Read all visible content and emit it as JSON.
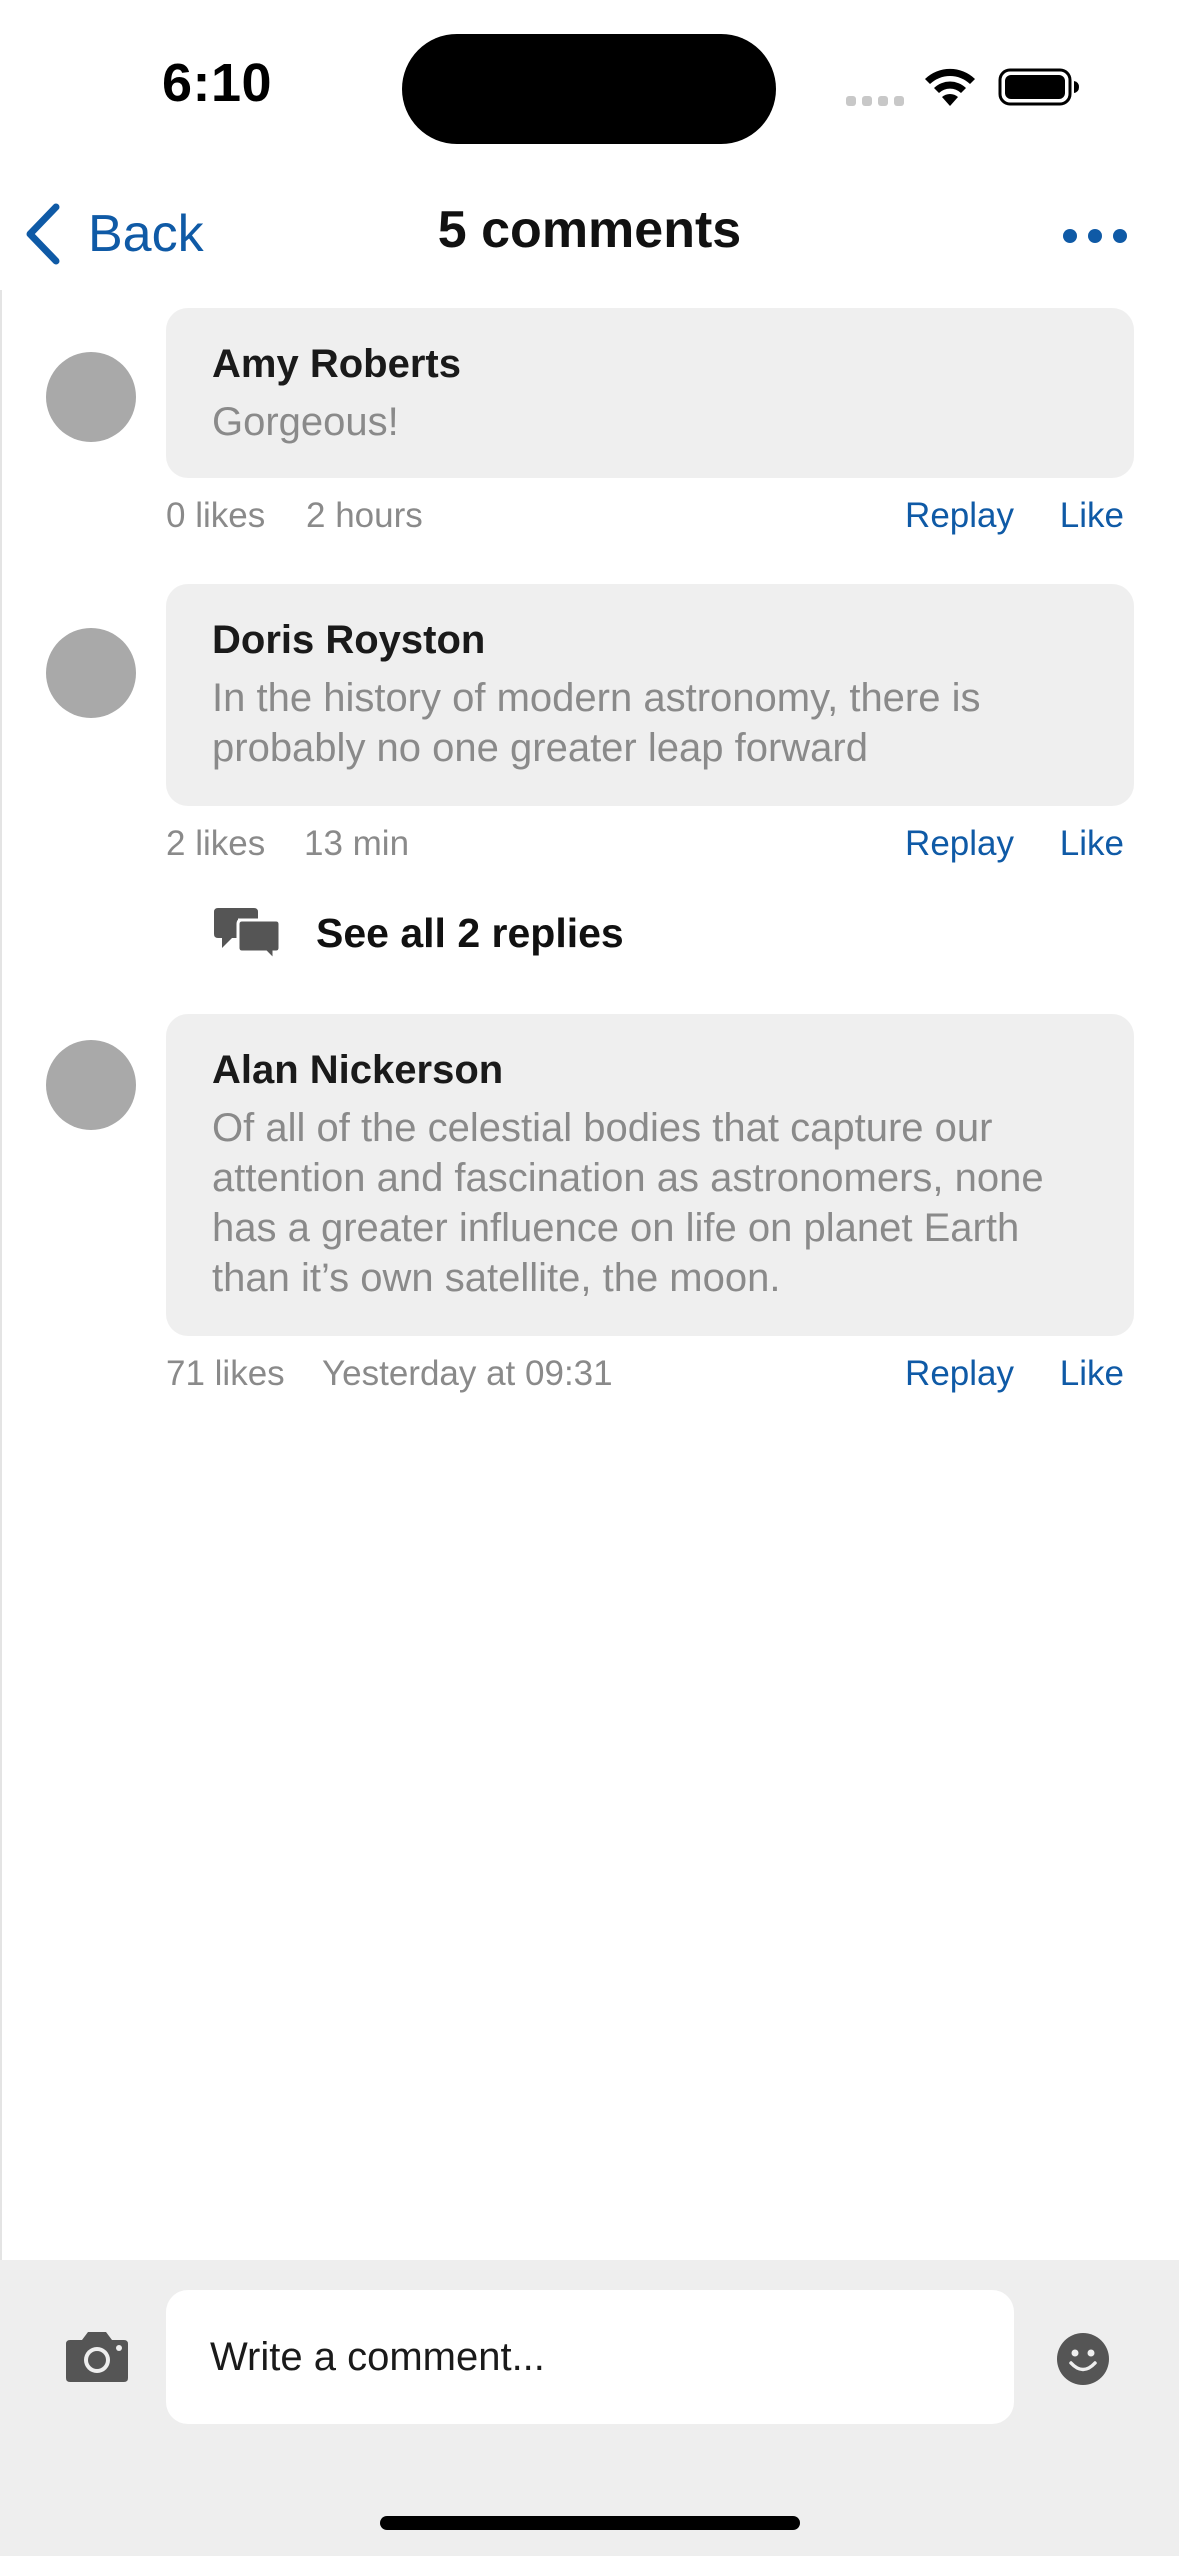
{
  "status_bar": {
    "time": "6:10"
  },
  "nav": {
    "back_label": "Back",
    "title": "5 comments"
  },
  "comments": [
    {
      "author": "Amy Roberts",
      "text": "Gorgeous!",
      "likes": "0 likes",
      "time": "2 hours",
      "reply_label": "Replay",
      "like_label": "Like"
    },
    {
      "author": "Doris Royston",
      "text": "In the history of modern astronomy, there is probably no one greater leap forward",
      "likes": "2 likes",
      "time": "13 min",
      "reply_label": "Replay",
      "like_label": "Like",
      "replies_label": "See all 2 replies"
    },
    {
      "author": "Alan Nickerson",
      "text": "Of all of the celestial bodies that capture our attention and fascination as astronomers, none has a greater influence on life on planet Earth than it’s own satellite, the moon.",
      "likes": "71 likes",
      "time": "Yesterday at 09:31",
      "reply_label": "Replay",
      "like_label": "Like"
    }
  ],
  "composer": {
    "placeholder": "Write a comment..."
  },
  "colors": {
    "accent": "#0f5aa6",
    "bubble": "#efefef",
    "muted_text": "#8a8a8a",
    "avatar": "#a9a9a9",
    "composer_bg": "#eeeeee"
  },
  "icons": {
    "back": "chevron-left-icon",
    "more": "ellipsis-icon",
    "replies": "speech-bubbles-icon",
    "camera": "camera-icon",
    "emoji": "smiley-icon"
  }
}
